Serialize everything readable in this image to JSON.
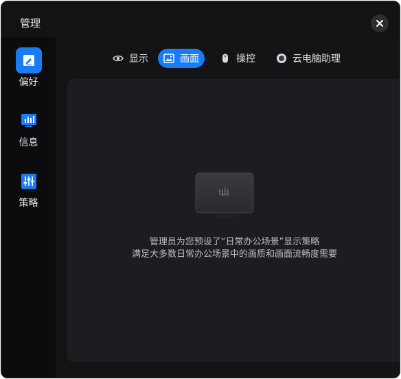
{
  "window": {
    "title": "管理"
  },
  "sidebar": {
    "items": [
      {
        "label": "偏好",
        "icon": "edit-icon",
        "active": true
      },
      {
        "label": "信息",
        "icon": "monitor-stats-icon",
        "active": false
      },
      {
        "label": "策略",
        "icon": "sliders-icon",
        "active": false
      }
    ]
  },
  "tabs": [
    {
      "label": "显示",
      "icon": "eye-icon",
      "active": false
    },
    {
      "label": "画面",
      "icon": "image-icon",
      "active": true
    },
    {
      "label": "操控",
      "icon": "mouse-icon",
      "active": false
    },
    {
      "label": "云电脑助理",
      "icon": "assistant-icon",
      "active": false
    }
  ],
  "content": {
    "message_line1": "管理员为您预设了“日常办公场景”显示策略",
    "message_line2": "满足大多数日常办公场景中的画质和画面流畅度需要"
  },
  "colors": {
    "accent": "#1a7cf5",
    "window_bg": "#141417",
    "sidebar_bg": "#0c0c0f",
    "panel_bg": "#1d1d21"
  }
}
